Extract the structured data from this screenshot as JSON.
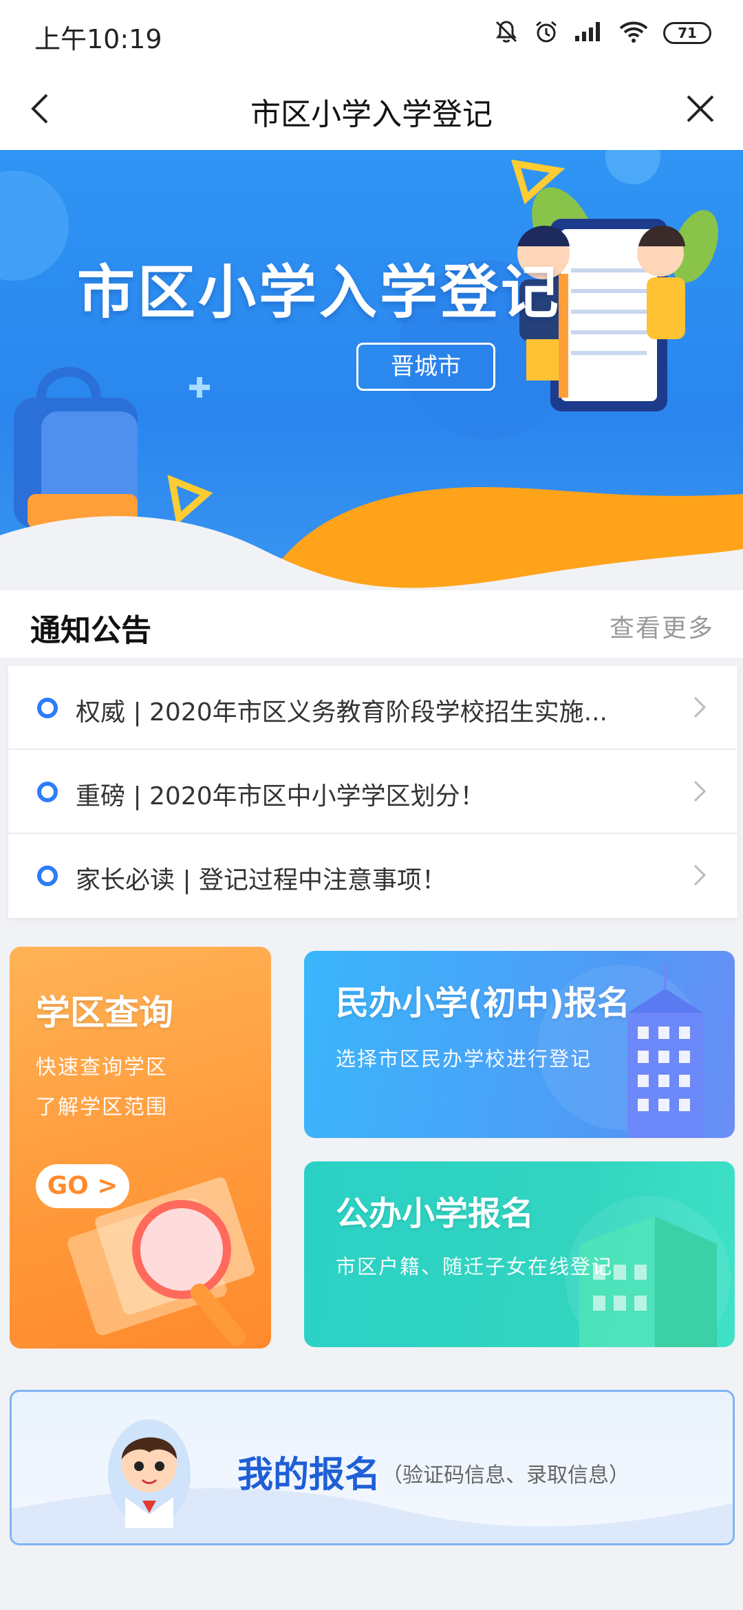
{
  "status_bar": {
    "time": "上午10:19",
    "battery": "71",
    "icons": [
      "mute-icon",
      "alarm-icon",
      "signal-icon",
      "wifi-icon",
      "battery-icon"
    ]
  },
  "nav": {
    "title": "市区小学入学登记",
    "back_icon": "chevron-left-icon",
    "close_icon": "close-icon"
  },
  "banner": {
    "title": "市区小学入学登记",
    "city": "晋城市",
    "colors": {
      "background": "#2f95f4",
      "accent": "#ffa31a"
    }
  },
  "notice": {
    "title": "通知公告",
    "more": "查看更多",
    "items": [
      {
        "text": "权威 | 2020年市区义务教育阶段学校招生实施..."
      },
      {
        "text": "重磅 | 2020年市区中小学学区划分！"
      },
      {
        "text": "家长必读 | 登记过程中注意事项！"
      }
    ]
  },
  "cards": {
    "district": {
      "title": "学区查询",
      "line1": "快速查询学区",
      "line2": "了解学区范围",
      "button": "GO >"
    },
    "private": {
      "title": "民办小学(初中)报名",
      "subtitle": "选择市区民办学校进行登记"
    },
    "public": {
      "title": "公办小学报名",
      "subtitle": "市区户籍、随迁子女在线登记"
    }
  },
  "my_registration": {
    "title": "我的报名",
    "subtitle": "（验证码信息、录取信息）"
  }
}
